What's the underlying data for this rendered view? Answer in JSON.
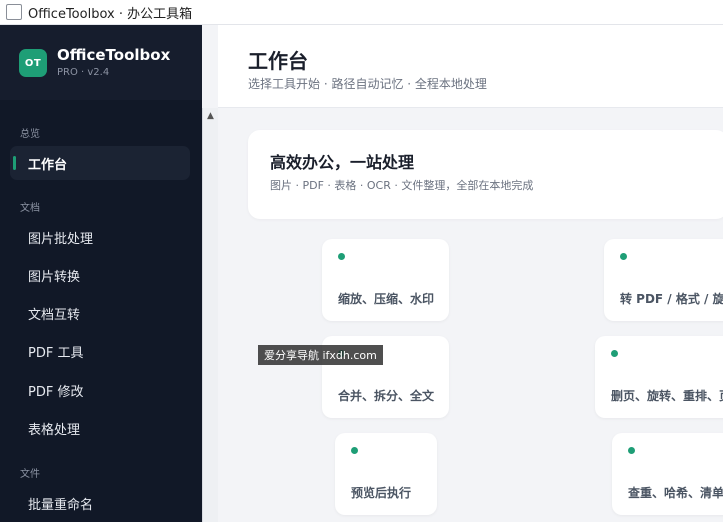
{
  "window": {
    "title": "OfficeToolbox · 办公工具箱"
  },
  "brand": {
    "logo": "OT",
    "name": "OfficeToolbox",
    "version": "PRO · v2.4"
  },
  "sidebar": {
    "sections": [
      "总览",
      "文档",
      "文件"
    ],
    "items": [
      "工作台",
      "图片批处理",
      "图片转换",
      "文档互转",
      "PDF 工具",
      "PDF 修改",
      "表格处理",
      "批量重命名"
    ]
  },
  "header": {
    "title": "工作台",
    "subtitle": "选择工具开始 · 路径自动记忆 · 全程本地处理"
  },
  "hero": {
    "title": "高效办公，一站处理",
    "subtitle": "图片 · PDF · 表格 · OCR · 文件整理，全部在本地完成"
  },
  "cards": [
    "缩放、压缩、水印",
    "转 PDF / 格式 / 旋转",
    "合并、拆分、全文",
    "删页、旋转、重排、页",
    "预览后执行",
    "查重、哈希、清单"
  ],
  "watermark": "爱分享导航 ifxdh.com",
  "colors": {
    "accent": "#1e9e76",
    "sidebar": "#111827"
  }
}
